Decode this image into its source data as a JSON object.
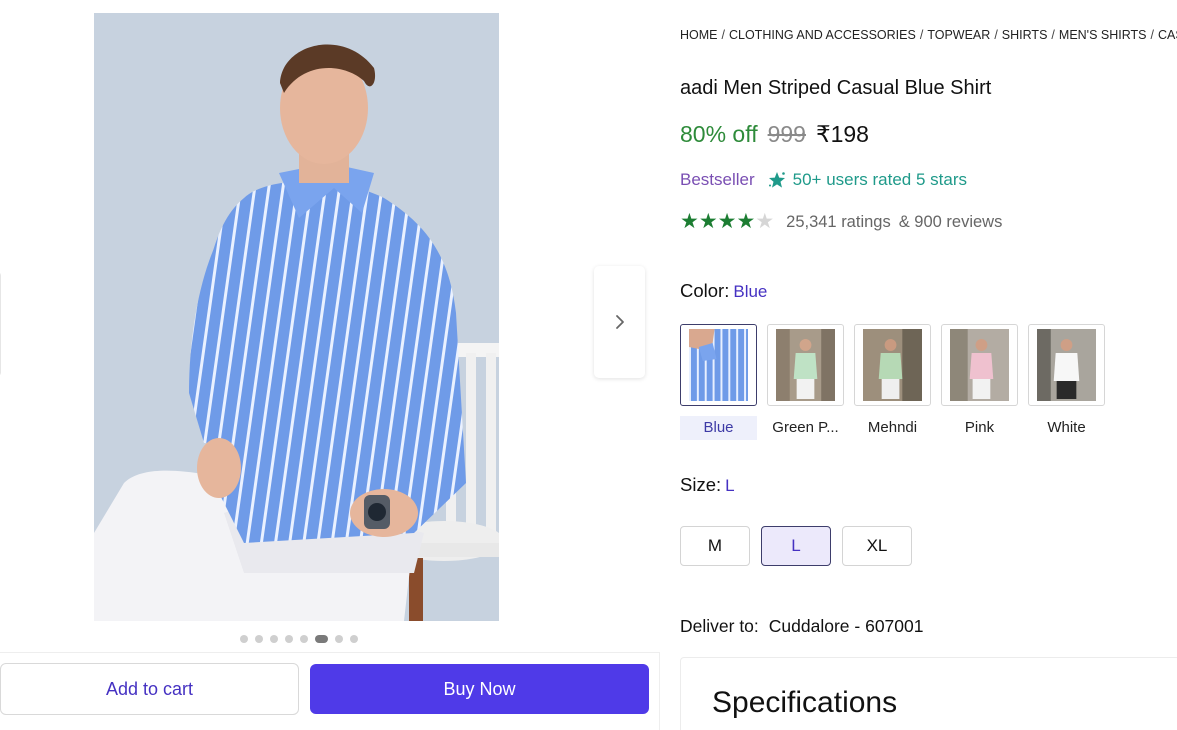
{
  "gallery": {
    "image_alt": "Man wearing blue striped shirt and white trousers sitting on a white chair",
    "next_icon": "chevron-right-icon",
    "dots_count": 8,
    "active_dot": 5
  },
  "actions": {
    "add_to_cart": "Add to cart",
    "buy_now": "Buy Now"
  },
  "breadcrumb": [
    "HOME",
    "CLOTHING AND ACCESSORIES",
    "TOPWEAR",
    "SHIRTS",
    "MEN'S SHIRTS",
    "CASUAL SHIRTS"
  ],
  "product": {
    "title": "aadi Men Striped Casual Blue Shirt",
    "discount": "80% off",
    "mrp": "999",
    "price": "₹198",
    "bestseller": "Bestseller",
    "rated_icon": "sparkle-star-icon",
    "rated_text": "50+ users rated 5 stars",
    "rating_stars": 4,
    "ratings_count": "25,341 ratings",
    "reviews_count": "& 900 reviews"
  },
  "color": {
    "label": "Color:",
    "selected": "Blue",
    "options": [
      "Blue",
      "Green P...",
      "Mehndi",
      "Pink",
      "White"
    ]
  },
  "size": {
    "label": "Size:",
    "selected": "L",
    "options": [
      "M",
      "L",
      "XL"
    ]
  },
  "delivery": {
    "label": "Deliver to:",
    "location": "Cuddalore - 607001"
  },
  "specs": {
    "title": "Specifications"
  },
  "colors": {
    "accent": "#4f3ae8",
    "link": "#4531c2",
    "discount_green": "#2e8b3a",
    "star_green": "#1c7d32",
    "bestseller_purple": "#7a4fb3",
    "rated_teal": "#1f9a8a"
  }
}
